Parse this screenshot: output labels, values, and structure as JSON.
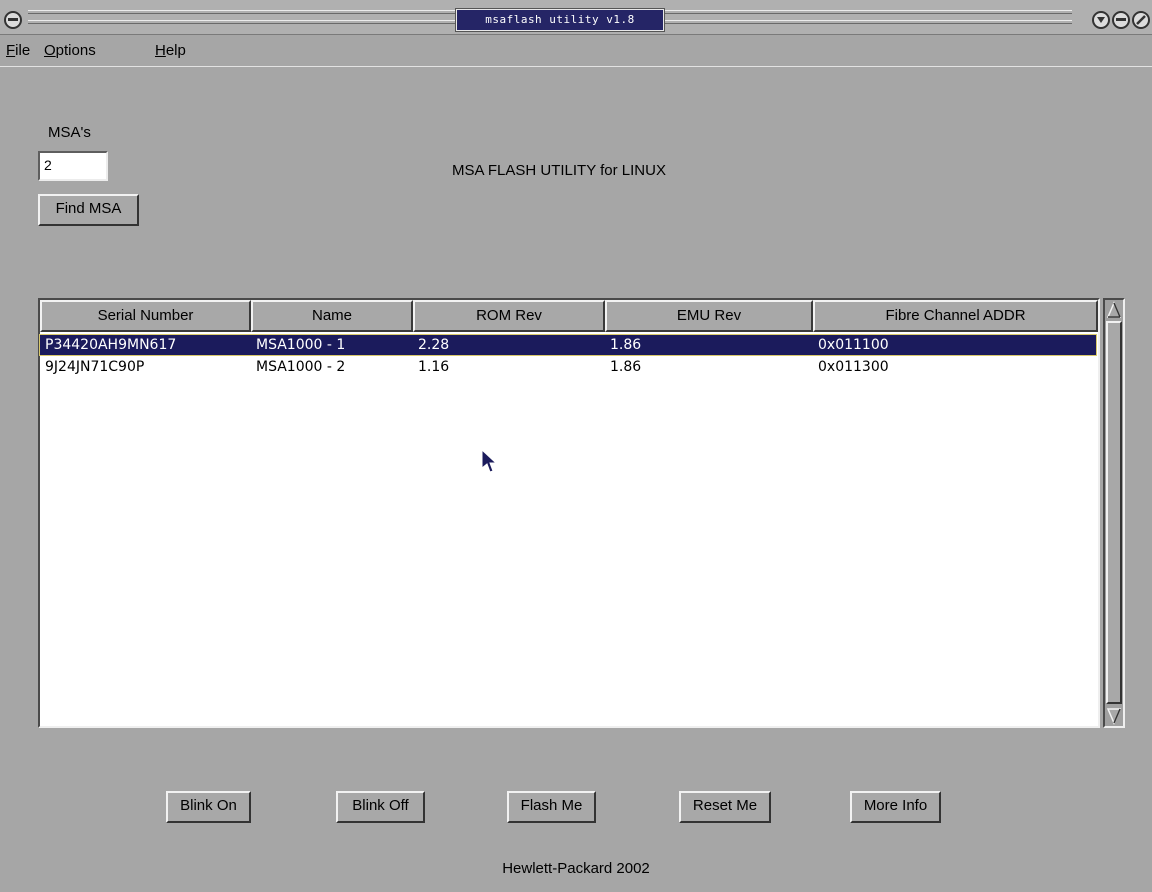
{
  "window": {
    "title": "msaflash utility v1.8"
  },
  "menu": {
    "items": [
      {
        "mnemonic": "F",
        "rest": "ile"
      },
      {
        "mnemonic": "O",
        "rest": "ptions"
      },
      {
        "mnemonic": "H",
        "rest": "elp"
      }
    ]
  },
  "msa_panel": {
    "label": "MSA's",
    "count_value": "2",
    "find_button": "Find MSA"
  },
  "heading": "MSA FLASH UTILITY for LINUX",
  "table": {
    "columns": [
      "Serial Number",
      "Name",
      "ROM Rev",
      "EMU Rev",
      "Fibre Channel ADDR"
    ],
    "rows": [
      {
        "serial": "P34420AH9MN617",
        "name": "MSA1000 - 1",
        "rom": "2.28",
        "emu": "1.86",
        "fc_addr": "0x011100",
        "selected": true
      },
      {
        "serial": "9J24JN71C90P",
        "name": "MSA1000 - 2",
        "rom": "1.16",
        "emu": "1.86",
        "fc_addr": "0x011300",
        "selected": false
      }
    ]
  },
  "actions": {
    "blink_on": "Blink On",
    "blink_off": "Blink Off",
    "flash_me": "Flash Me",
    "reset_me": "Reset Me",
    "more_info": "More Info"
  },
  "footer": "Hewlett-Packard 2002",
  "colors": {
    "window_bg": "#a6a6a6",
    "title_bg": "#252566",
    "selection_bg": "#1b1b5c",
    "selection_fg": "#ffffff"
  }
}
